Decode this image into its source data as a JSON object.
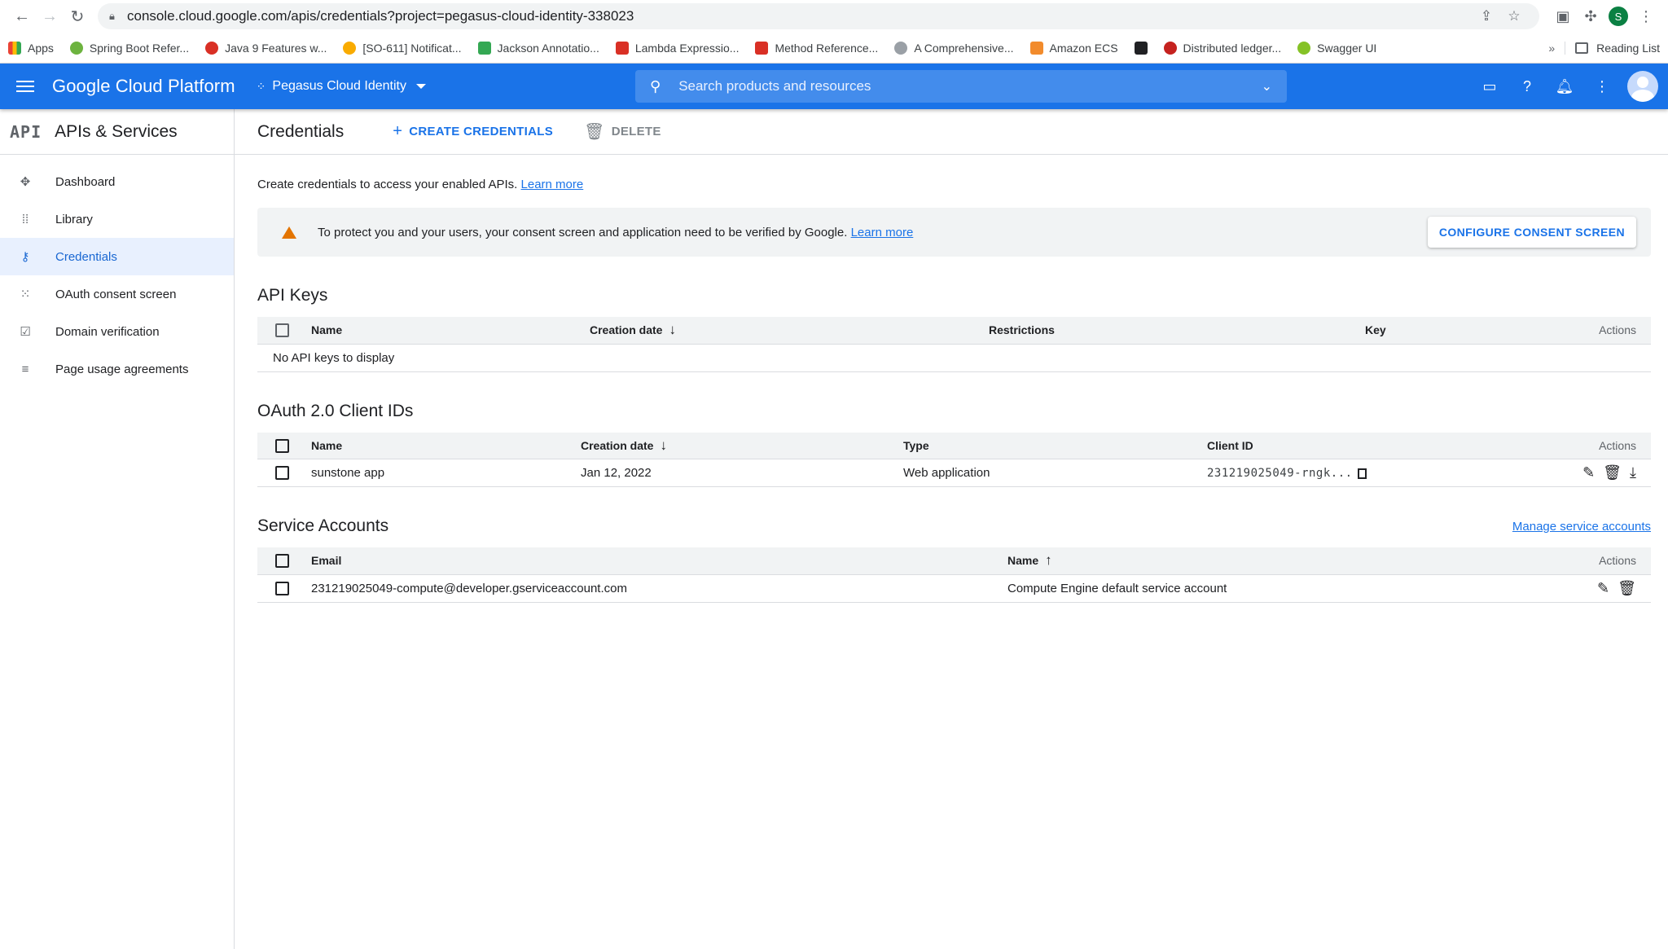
{
  "browser": {
    "url": "console.cloud.google.com/apis/credentials?project=pegasus-cloud-identity-338023",
    "profile_initial": "S",
    "bookmarks": [
      {
        "label": "Apps",
        "color": "#ea4335"
      },
      {
        "label": "Spring Boot Refer...",
        "color": "#6db33f"
      },
      {
        "label": "Java 9 Features w...",
        "color": "#d93025"
      },
      {
        "label": "[SO-611] Notificat...",
        "color": "#f9ab00"
      },
      {
        "label": "Jackson Annotatio...",
        "color": "#34a853"
      },
      {
        "label": "Lambda Expressio...",
        "color": "#d93025"
      },
      {
        "label": "Method Reference...",
        "color": "#d93025"
      },
      {
        "label": "A Comprehensive...",
        "color": "#9aa0a6"
      },
      {
        "label": "Amazon ECS",
        "color": "#f28b2c"
      },
      {
        "label": "",
        "color": "#202124"
      },
      {
        "label": "Distributed ledger...",
        "color": "#c5221f"
      },
      {
        "label": "Swagger UI",
        "color": "#85c226"
      }
    ],
    "more": "»",
    "reading_list": "Reading List"
  },
  "header": {
    "brand": "Google Cloud Platform",
    "project": "Pegasus Cloud Identity",
    "search_placeholder": "Search products and resources"
  },
  "sidebar": {
    "logo": "API",
    "title": "APIs & Services",
    "items": [
      {
        "label": "Dashboard",
        "icon": "dashboard-icon"
      },
      {
        "label": "Library",
        "icon": "library-icon"
      },
      {
        "label": "Credentials",
        "icon": "key-icon",
        "active": true
      },
      {
        "label": "OAuth consent screen",
        "icon": "consent-icon"
      },
      {
        "label": "Domain verification",
        "icon": "checkbox-icon"
      },
      {
        "label": "Page usage agreements",
        "icon": "settings-list-icon"
      }
    ]
  },
  "toolbar": {
    "title": "Credentials",
    "create": "CREATE CREDENTIALS",
    "delete": "DELETE"
  },
  "intro": {
    "text": "Create credentials to access your enabled APIs.",
    "link": "Learn more"
  },
  "banner": {
    "text": "To protect you and your users, your consent screen and application need to be verified by Google.",
    "link": "Learn more",
    "button": "CONFIGURE CONSENT SCREEN"
  },
  "api_keys": {
    "title": "API Keys",
    "columns": [
      "Name",
      "Creation date",
      "Restrictions",
      "Key",
      "Actions"
    ],
    "empty": "No API keys to display"
  },
  "oauth": {
    "title": "OAuth 2.0 Client IDs",
    "columns": [
      "Name",
      "Creation date",
      "Type",
      "Client ID",
      "Actions"
    ],
    "rows": [
      {
        "name": "sunstone app",
        "date": "Jan 12, 2022",
        "type": "Web application",
        "client_id": "231219025049-rngk..."
      }
    ]
  },
  "service_accounts": {
    "title": "Service Accounts",
    "manage_link": "Manage service accounts",
    "columns": [
      "Email",
      "Name",
      "Actions"
    ],
    "rows": [
      {
        "email": "231219025049-compute@developer.gserviceaccount.com",
        "name": "Compute Engine default service account"
      }
    ]
  }
}
